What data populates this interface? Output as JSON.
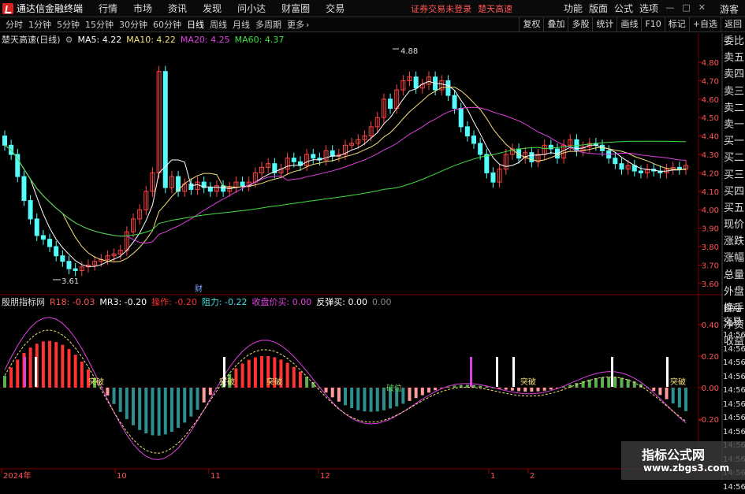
{
  "app": {
    "title": "通达信金融终端",
    "menus": [
      "行情",
      "市场",
      "资讯",
      "发现",
      "问小达",
      "财富圈",
      "交易"
    ],
    "warning": "证券交易未登录",
    "stock": "楚天高速",
    "right_menus": [
      "功能",
      "版面",
      "公式",
      "选项"
    ],
    "window_controls": [
      "—",
      "□",
      "✕"
    ],
    "user": "游客"
  },
  "toolbar": {
    "periods": [
      "分时",
      "1分钟",
      "5分钟",
      "15分钟",
      "30分钟",
      "60分钟",
      "日线",
      "周线",
      "月线",
      "多周期",
      "更多"
    ],
    "active": "日线",
    "right_buttons": [
      "复权",
      "叠加",
      "多股",
      "统计",
      "画线",
      "F10",
      "标记",
      "+自选",
      "返回"
    ]
  },
  "main_chart": {
    "title": "楚天高速(日线)",
    "ma5": {
      "label": "MA5:",
      "value": "4.22",
      "color": "#ffffff"
    },
    "ma10": {
      "label": "MA10:",
      "value": "4.22",
      "color": "#f5e07a"
    },
    "ma20": {
      "label": "MA20:",
      "value": "4.25",
      "color": "#e040e0"
    },
    "ma60": {
      "label": "MA60:",
      "value": "4.37",
      "color": "#40e040"
    },
    "yaxis": [
      "4.80",
      "4.70",
      "4.60",
      "4.50",
      "4.40",
      "4.30",
      "4.20",
      "4.10",
      "4.00",
      "3.90",
      "3.80",
      "3.70",
      "3.60"
    ],
    "high_label": "4.88",
    "low_label": "3.61",
    "marker": "财"
  },
  "indicator": {
    "name": "殷朋指标网",
    "fields": [
      {
        "label": "R18:",
        "value": "-0.03",
        "color": "#ff5555"
      },
      {
        "label": "MR3:",
        "value": "-0.20",
        "color": "#ffffff"
      },
      {
        "label": "操作:",
        "value": "-0.20",
        "color": "#ff3030"
      },
      {
        "label": "阻力:",
        "value": "-0.22",
        "color": "#40e0e0"
      },
      {
        "label": "收盘价买:",
        "value": "0.00",
        "color": "#e040e0"
      },
      {
        "label": "反弹买:",
        "value": "0.00",
        "color": "#ffffff"
      },
      {
        "label": "",
        "value": "0.00",
        "color": "#888888"
      }
    ],
    "yaxis": [
      "0.40",
      "0.20",
      "0.00",
      "-0.20"
    ],
    "signals": [
      "突破",
      "突破",
      "突破",
      "破位",
      "突破",
      "突破"
    ]
  },
  "xaxis": [
    "2024年",
    "10",
    "11",
    "12",
    "1",
    "2"
  ],
  "right_panel": [
    "委比",
    "卖五",
    "卖四",
    "卖三",
    "卖二",
    "卖一",
    "买一",
    "买二",
    "买三",
    "买四",
    "买五",
    "现价",
    "涨跌",
    "涨幅",
    "总量",
    "外盘",
    "换手",
    "净资",
    "收益"
  ],
  "right_panel2": {
    "labels": [
      "自动",
      "交易"
    ],
    "times": [
      "14:56",
      "14:56",
      "14:56",
      "14:56",
      "14:56",
      "14:56",
      "14:56",
      "14:56",
      "14:56",
      "14:56",
      "14:56",
      "14:56"
    ]
  },
  "watermark": {
    "line1": "指标公式网",
    "line2": "www.zbgs3.com"
  },
  "colors": {
    "up": "#ff4444",
    "down": "#54fcfc",
    "grid": "#8b0000"
  }
}
